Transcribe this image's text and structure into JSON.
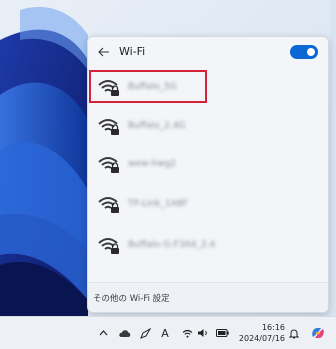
{
  "wifi_panel": {
    "title": "Wi-Fi",
    "toggle_state": "on",
    "networks": [
      {
        "ssid": "Buffalo_5G"
      },
      {
        "ssid": "Buffalo_2.4G"
      },
      {
        "ssid": "wew-hwg2"
      },
      {
        "ssid": "TP-Link_1A8F"
      },
      {
        "ssid": "Buffalo-G-F3A4_2.4"
      }
    ],
    "other_settings": "その他の Wi-Fi 設定"
  },
  "taskbar": {
    "time": "16:16",
    "date": "2024/07/16",
    "ime_label": "A"
  },
  "colors": {
    "accent": "#0b66d6",
    "highlight": "#d4243b"
  },
  "icons": [
    "back-arrow-icon",
    "wifi-secured-icon",
    "chevron-up-icon",
    "onedrive-cloud-icon",
    "pen-icon",
    "wifi-icon",
    "speaker-icon",
    "battery-icon",
    "bell-icon",
    "copilot-icon"
  ]
}
